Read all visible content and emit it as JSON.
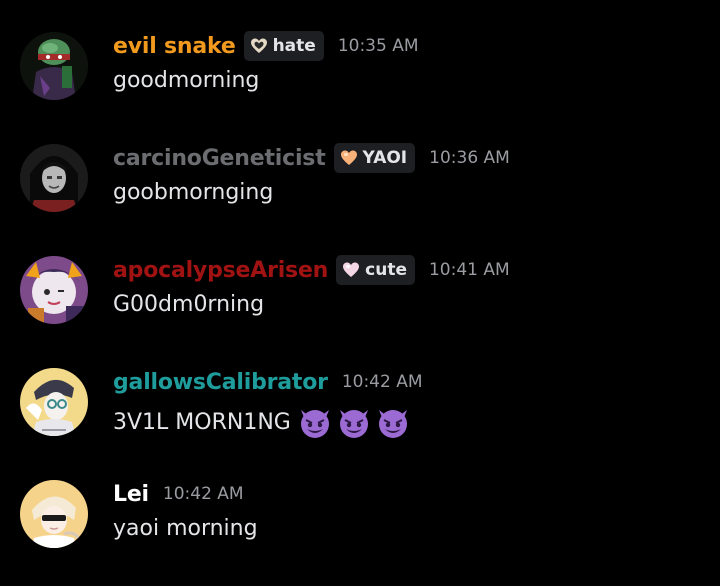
{
  "messages": [
    {
      "username": "evil snake",
      "username_color": "#f29a1e",
      "tag": {
        "label": "hate",
        "icon": "dark-heart-icon"
      },
      "timestamp": "10:35 AM",
      "content": "goodmorning"
    },
    {
      "username": "carcinoGeneticist",
      "username_color": "#6c6d70",
      "tag": {
        "label": "YAOI",
        "icon": "peach-heart-icon"
      },
      "timestamp": "10:36 AM",
      "content": "goobmornging"
    },
    {
      "username": "apocalypseArisen",
      "username_color": "#a11212",
      "tag": {
        "label": "cute",
        "icon": "pink-heart-icon"
      },
      "timestamp": "10:41 AM",
      "content": "G00dm0rning"
    },
    {
      "username": "gallowsCalibrator",
      "username_color": "#1f9c9c",
      "timestamp": "10:42 AM",
      "content": "3V1L MORN1NG",
      "emojis": [
        "smiling-imp-emoji",
        "smiling-imp-emoji",
        "smiling-imp-emoji"
      ]
    },
    {
      "username": "Lei",
      "username_color": "#ffffff",
      "timestamp": "10:42 AM",
      "content": "yaoi morning"
    }
  ]
}
